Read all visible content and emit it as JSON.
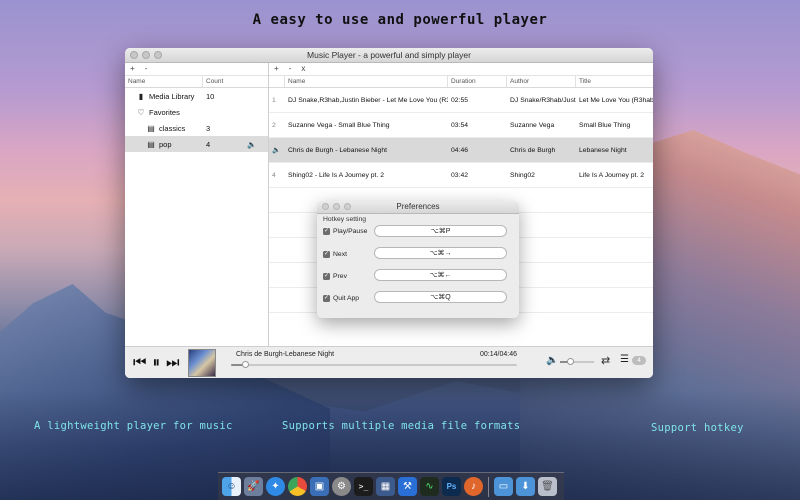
{
  "headline": "A easy to use and powerful player",
  "captions": [
    "A lightweight player for music",
    "Supports multiple media file formats",
    "Support hotkey"
  ],
  "window": {
    "title": "Music Player - a powerful and simply player",
    "sidebar": {
      "toolbar": [
        "+",
        "-"
      ],
      "headers": [
        "Name",
        "Count"
      ],
      "items": [
        {
          "icon": "file-icon",
          "glyph": "▮",
          "label": "Media Library",
          "count": "10"
        },
        {
          "icon": "heart-icon",
          "glyph": "♡",
          "label": "Favorites",
          "count": ""
        },
        {
          "icon": "playlist-icon",
          "glyph": "▤",
          "label": "classics",
          "count": "3"
        },
        {
          "icon": "playlist-icon",
          "glyph": "▤",
          "label": "pop",
          "count": "4",
          "selected": true,
          "speaker": "🔈"
        }
      ]
    },
    "tracks": {
      "toolbar": [
        "+",
        "-",
        "x"
      ],
      "headers": [
        "",
        "Name",
        "Duration",
        "Author",
        "Title"
      ],
      "rows": [
        {
          "num": "1",
          "name": "DJ Snake,R3hab,Justin Bieber - Let Me Love You (R3hab Remix)",
          "duration": "02:55",
          "author": "DJ Snake/R3hab/Justin",
          "title": "Let Me Love You (R3hab"
        },
        {
          "num": "2",
          "name": "Suzanne Vega - Small Blue Thing",
          "duration": "03:54",
          "author": "Suzanne Vega",
          "title": "Small Blue Thing"
        },
        {
          "num": "3",
          "name": "Chris de Burgh - Lebanese Night",
          "duration": "04:46",
          "author": "Chris de Burgh",
          "title": "Lebanese Night",
          "playing": true
        },
        {
          "num": "4",
          "name": "Shing02 - Life Is A Journey pt. 2",
          "duration": "03:42",
          "author": "Shing02",
          "title": "Life Is A Journey pt. 2"
        }
      ]
    },
    "player": {
      "now_playing": "Chris de Burgh-Lebanese Night",
      "time": "00:14/04:46",
      "progress": 0.049,
      "volume": 0.3,
      "playlist_count": "4"
    }
  },
  "preferences": {
    "title": "Preferences",
    "section": "Hotkey setting",
    "hotkeys": [
      {
        "label": "Play/Pause",
        "key": "⌥⌘P",
        "checked": true
      },
      {
        "label": "Next",
        "key": "⌥⌘→",
        "checked": true
      },
      {
        "label": "Prev",
        "key": "⌥⌘←",
        "checked": true
      },
      {
        "label": "Quit App",
        "key": "⌥⌘Q",
        "checked": true
      }
    ]
  },
  "dock": [
    "finder-icon",
    "launchpad-icon",
    "safari-icon",
    "chrome-icon",
    "preview-icon",
    "system-preferences-icon",
    "terminal-icon",
    "mission-control-icon",
    "xcode-icon",
    "activity-monitor-icon",
    "photoshop-icon",
    "music-player-icon",
    "folder-icon",
    "downloads-icon",
    "trash-icon"
  ],
  "colors": {
    "caption": "#7fe3e8",
    "selection": "#d9d9d9"
  }
}
